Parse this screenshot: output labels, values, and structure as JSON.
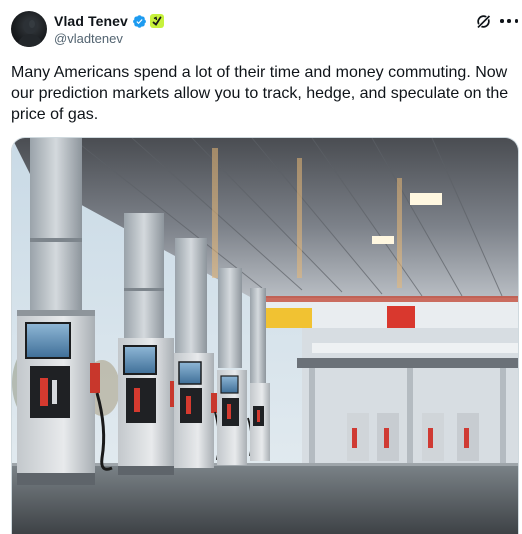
{
  "author": {
    "display_name": "Vlad Tenev",
    "handle": "@vladtenev",
    "avatar": "avatar-image",
    "badges": [
      "verified-badge-icon",
      "affiliate-badge-icon"
    ]
  },
  "header_actions": {
    "grok": "grok-icon",
    "more": "more-icon"
  },
  "tweet": {
    "text": "Many Americans spend a lot of their time and money commuting. Now our prediction markets allow you to track, hedge, and speculate on the price of gas."
  },
  "media": {
    "kind": "photo",
    "subject": "gas-station-pumps-image"
  },
  "colors": {
    "text": "#0f1419",
    "secondary": "#536471",
    "verified_blue": "#1d9bf0",
    "affiliate_green": "#c7f23c",
    "border": "#cfd9de"
  }
}
